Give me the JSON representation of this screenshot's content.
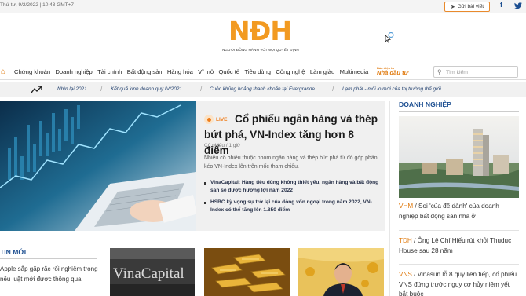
{
  "topbar": {
    "date": "Thứ tư, 9/2/2022 | 10:43 GMT+7",
    "post_label": "Gửi bài viết"
  },
  "logo": {
    "letters": "NĐH",
    "tagline": "NGƯỜI ĐỒNG HÀNH VỚI MỌI QUYẾT ĐỊNH"
  },
  "nav": {
    "items": [
      "Chứng khoán",
      "Doanh nghiệp",
      "Tài chính",
      "Bất động sản",
      "Hàng hóa",
      "Vĩ mô",
      "Quốc tế",
      "Tiêu dùng",
      "Công nghệ",
      "Làm giàu",
      "Multimedia"
    ],
    "nhadautu_small": "Báo điện tử",
    "nhadautu_big": "Nhà đầu tư",
    "search_placeholder": "Tìm kiếm"
  },
  "trending": [
    "Nhìn lại 2021",
    "Kết quả kinh doanh quý IV/2021",
    "Cuộc khủng hoảng thanh khoản tại Evergrande",
    "Lạm phát - mối lo mới của thị trường thế giới"
  ],
  "hero": {
    "live_label": "LIVE",
    "title": "Cổ phiếu ngân hàng và thép bứt phá, VN-Index tăng hơn 8 điểm",
    "meta": "Cổ phiếu / 1 giờ",
    "sapo": "Nhiều cổ phiếu thuộc nhóm ngân hàng và thép bứt phá từ đó góp phần kéo VN-Index lên trên mốc tham chiếu.",
    "related": [
      "VinaCapital: Hàng tiêu dùng không thiết yếu, ngân hàng và bất động sản sẽ được hưởng lợi năm 2022",
      "HSBC kỳ vọng sự trở lại của dòng vốn ngoại trong năm 2022, VN-Index có thể tăng lên 1.850 điểm"
    ]
  },
  "doanh_nghiep": {
    "title": "DOANH NGHIỆP",
    "stories": [
      {
        "ticker": "VHM",
        "text": " / Soi 'của để dành' của doanh nghiệp bất động sản nhà ở"
      },
      {
        "ticker": "TDH",
        "text": " / Ông Lê Chí Hiếu rút khỏi Thuduc House sau 28 năm"
      },
      {
        "ticker": "VNS",
        "text": " / Vinasun lỗ 8 quý liên tiếp, cổ phiếu VNS đứng trước nguy cơ hủy niêm yết bắt buộc"
      }
    ]
  },
  "tin_moi": {
    "title": "TIN MỚI",
    "story": "Apple sắp gặp rắc rối nghiêm trọng nếu luật mới được thông qua"
  },
  "thumbs": {
    "vinacapital_text": "VinaCapital"
  },
  "colors": {
    "brand_orange": "#f29a21",
    "section_blue": "#1d4f91"
  }
}
